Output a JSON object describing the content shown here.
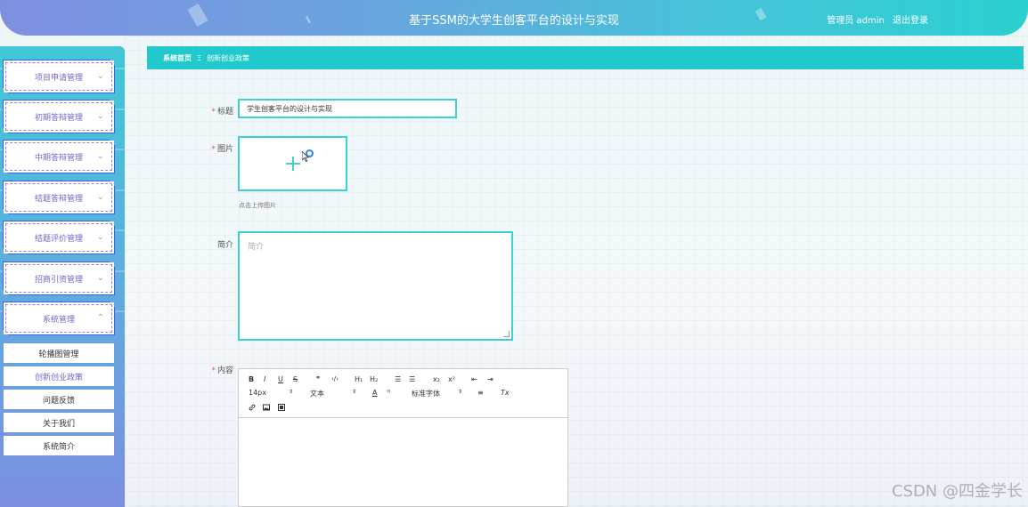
{
  "header": {
    "title": "基于SSM的大学生创客平台的设计与实现",
    "user_label": "管理员 admin",
    "logout_label": "退出登录"
  },
  "sidebar": {
    "items": [
      {
        "label": "项目申请管理",
        "icon": "chevron-down-icon"
      },
      {
        "label": "初期答辩管理",
        "icon": "chevron-down-icon"
      },
      {
        "label": "中期答辩管理",
        "icon": "chevron-down-icon"
      },
      {
        "label": "结题答辩管理",
        "icon": "chevron-down-icon"
      },
      {
        "label": "结题评价管理",
        "icon": "chevron-down-icon"
      },
      {
        "label": "招商引资管理",
        "icon": "chevron-down-icon"
      },
      {
        "label": "系统管理",
        "icon": "chevron-up-icon"
      }
    ],
    "subitems": [
      {
        "label": "轮播图管理"
      },
      {
        "label": "创新创业政策",
        "active": true
      },
      {
        "label": "问题反馈"
      },
      {
        "label": "关于我们"
      },
      {
        "label": "系统简介"
      }
    ]
  },
  "breadcrumb": {
    "home": "系统首页",
    "separator": "Ξ",
    "current": "创新创业政策"
  },
  "form": {
    "title_label": "标题",
    "title_value": "学生创客平台的设计与实现",
    "image_label": "图片",
    "upload_hint": "点击上传图片",
    "intro_label": "简介",
    "intro_placeholder": "简介",
    "content_label": "内容",
    "required_mark": "*"
  },
  "editor": {
    "bold": "B",
    "italic": "I",
    "underline": "U",
    "strike": "S",
    "quote": "❞",
    "code": "‹/›",
    "h1": "H₁",
    "h2": "H₂",
    "ordered_list": "☰",
    "bullet_list": "☰",
    "subscript": "x₂",
    "superscript": "x²",
    "outdent": "⇤",
    "indent": "⇥",
    "font_size": "14px",
    "text_type": "文本",
    "font_color": "A",
    "bg_color": "ꟸ",
    "font_family": "标准字体",
    "align": "≡",
    "clear_format": "Tx",
    "dropdown_arrow": "⇕"
  },
  "watermark": "CSDN @四金学长",
  "colors": {
    "accent": "#21c9cc",
    "header_start": "#7f8fe0",
    "header_end": "#2ad0d0",
    "menu_text": "#7a63c8",
    "required": "#e45b3c"
  }
}
